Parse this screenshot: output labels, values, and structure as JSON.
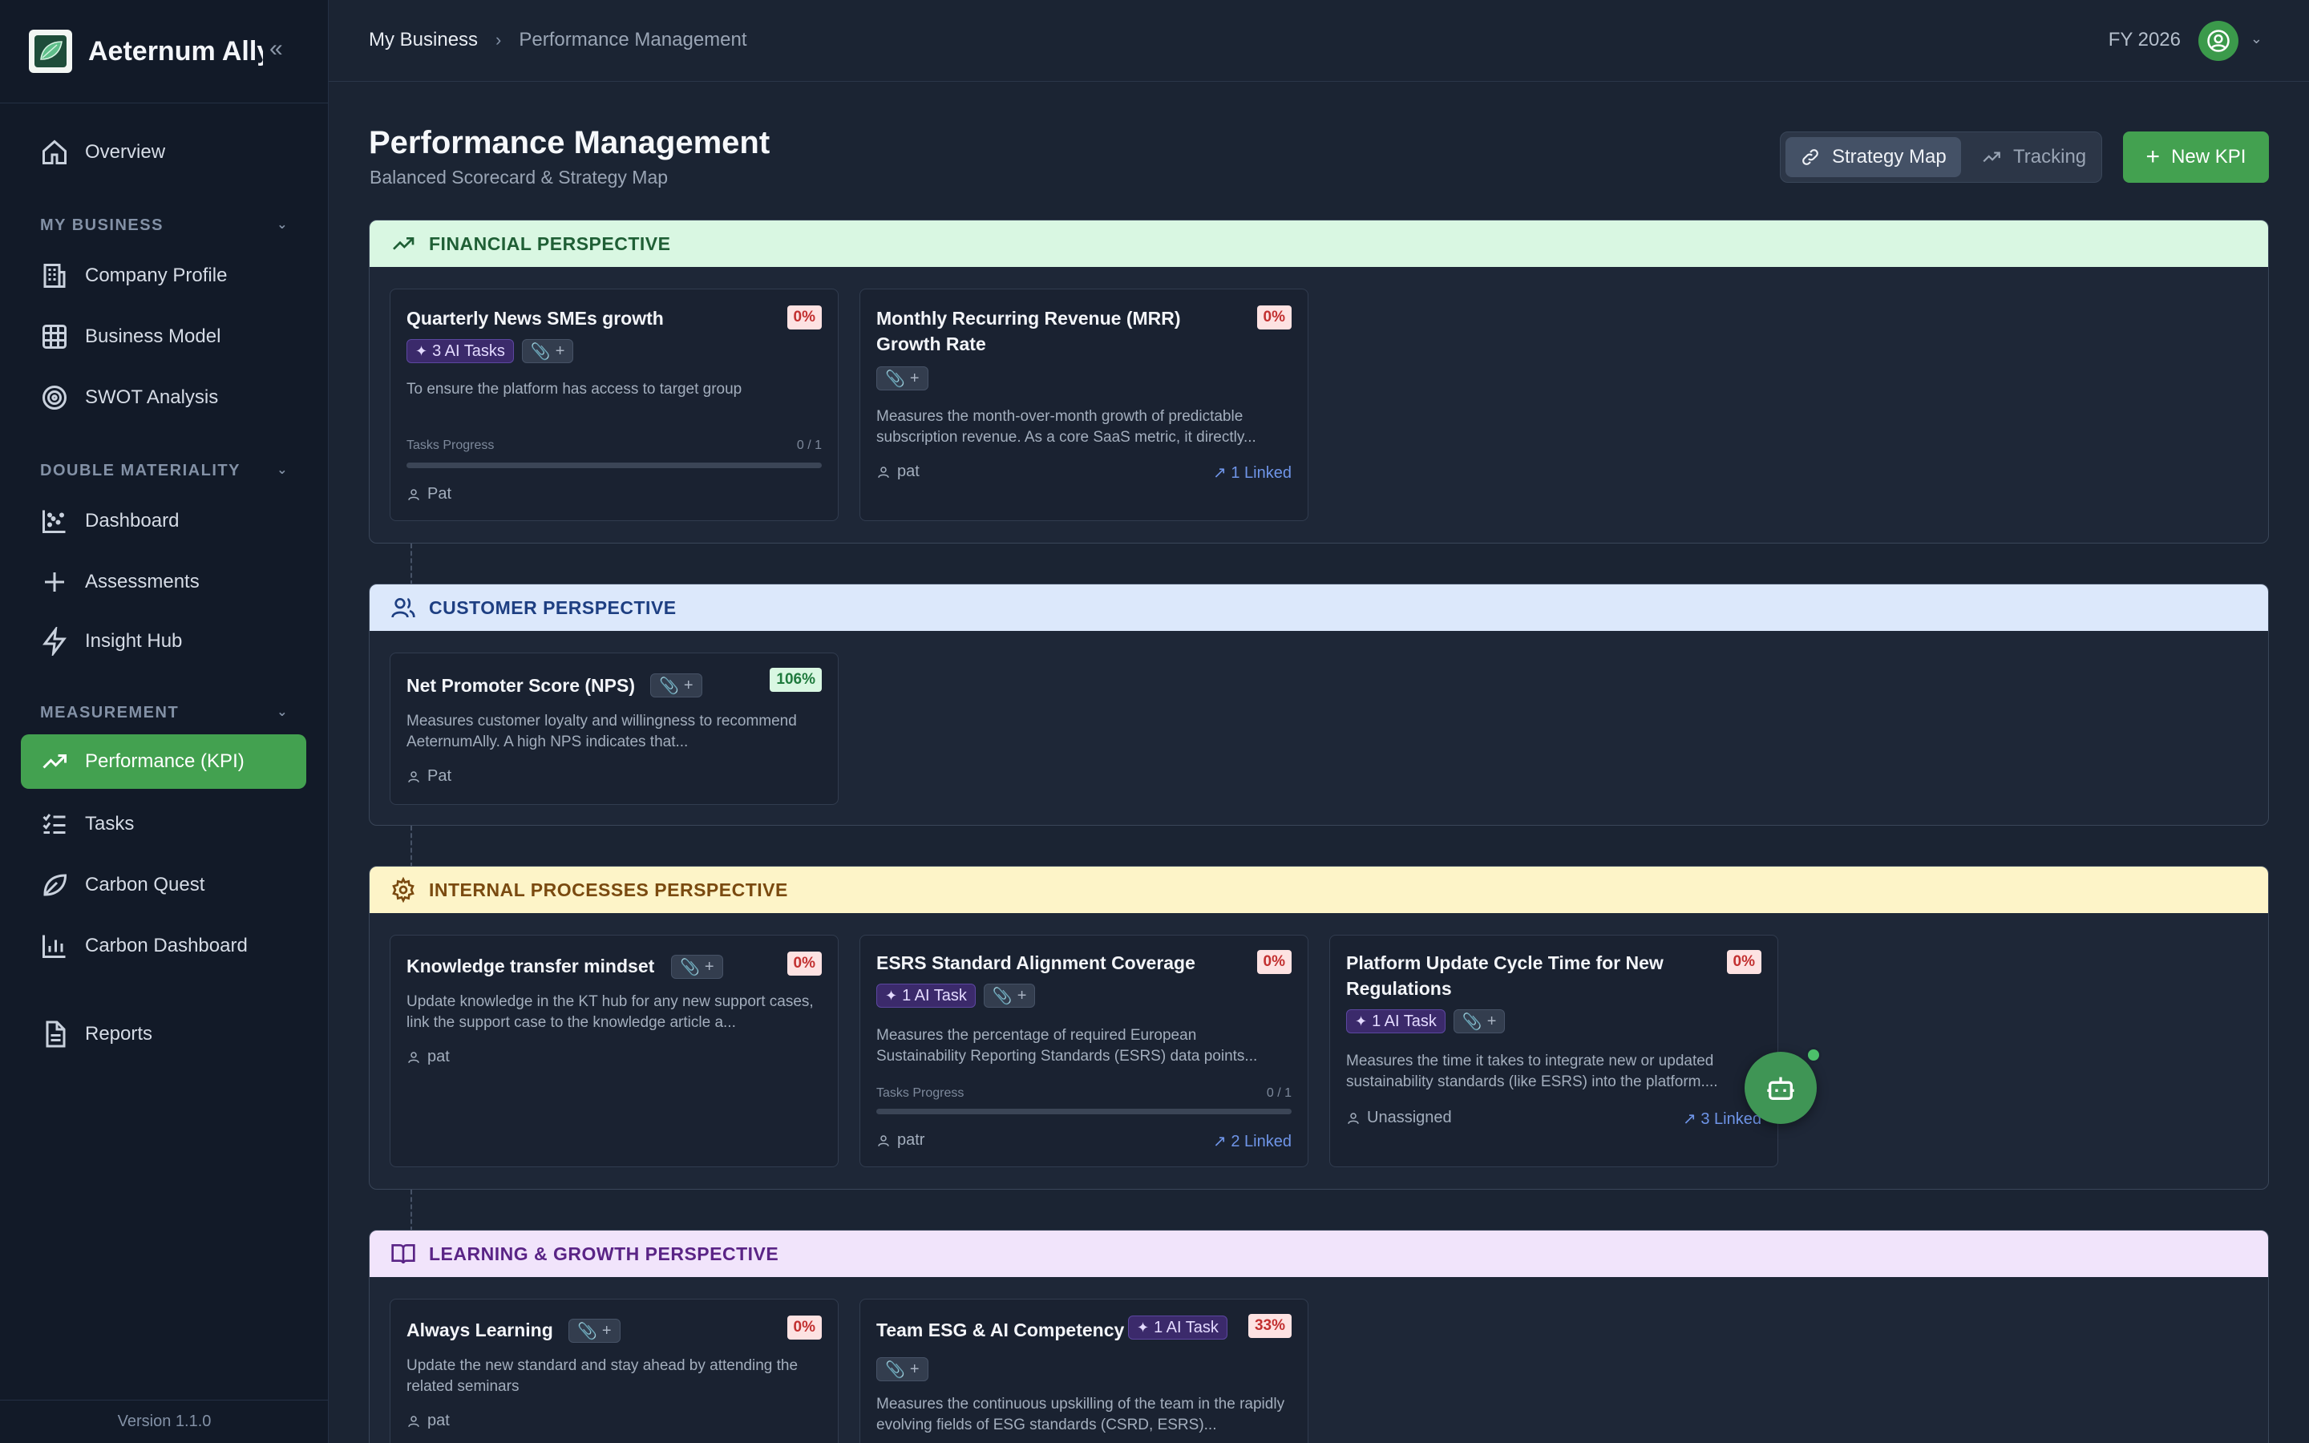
{
  "brand": {
    "name": "Aeternum Ally",
    "collapse_glyph": "«"
  },
  "sidebar": {
    "overview": "Overview",
    "sections": [
      {
        "label": "MY BUSINESS",
        "items": [
          "Company Profile",
          "Business Model",
          "SWOT Analysis"
        ]
      },
      {
        "label": "DOUBLE MATERIALITY",
        "items": [
          "Dashboard",
          "Assessments",
          "Insight Hub"
        ]
      },
      {
        "label": "MEASUREMENT",
        "items": [
          "Performance (KPI)",
          "Tasks",
          "Carbon Quest",
          "Carbon Dashboard"
        ]
      }
    ],
    "reports": "Reports",
    "version": "Version 1.1.0"
  },
  "topbar": {
    "breadcrumb": [
      "My Business",
      "Performance Management"
    ],
    "fiscal_year": "FY 2026"
  },
  "page": {
    "title": "Performance Management",
    "subtitle": "Balanced Scorecard & Strategy Map",
    "view_toggle": {
      "strategy_map": "Strategy Map",
      "tracking": "Tracking"
    },
    "new_kpi": "New KPI"
  },
  "common": {
    "attach_plus": "+",
    "tasks_progress": "Tasks Progress"
  },
  "perspectives": {
    "financial": {
      "title": "FINANCIAL PERSPECTIVE",
      "cards": [
        {
          "title": "Quarterly News SMEs growth",
          "percent": "0%",
          "ai_tasks": "3 AI Tasks",
          "description": "To ensure the platform has access to target group",
          "progress": "0 / 1",
          "progress_fraction": 0,
          "owner": "Pat"
        },
        {
          "title": "Monthly Recurring Revenue (MRR) Growth Rate",
          "percent": "0%",
          "description": "Measures the month-over-month growth of predictable subscription revenue. As a core SaaS metric, it directly...",
          "owner": "pat",
          "linked": "1 Linked"
        }
      ]
    },
    "customer": {
      "title": "CUSTOMER PERSPECTIVE",
      "cards": [
        {
          "title": "Net Promoter Score (NPS)",
          "percent": "106%",
          "description": "Measures customer loyalty and willingness to recommend AeternumAlly. A high NPS indicates that...",
          "owner": "Pat"
        }
      ]
    },
    "internal": {
      "title": "INTERNAL PROCESSES PERSPECTIVE",
      "cards": [
        {
          "title": "Knowledge transfer mindset",
          "percent": "0%",
          "description": "Update knowledge in the KT hub for any new support cases, link the support case to the knowledge article a...",
          "owner": "pat"
        },
        {
          "title": "ESRS Standard Alignment Coverage",
          "percent": "0%",
          "ai_tasks": "1 AI Task",
          "description": "Measures the percentage of required European Sustainability Reporting Standards (ESRS) data points...",
          "progress": "0 / 1",
          "progress_fraction": 0,
          "owner": "patr",
          "linked": "2 Linked"
        },
        {
          "title": "Platform Update Cycle Time for New Regulations",
          "percent": "0%",
          "ai_tasks": "1 AI Task",
          "description": "Measures the time it takes to integrate new or updated sustainability standards (like ESRS) into the platform....",
          "owner": "Unassigned",
          "linked": "3 Linked"
        }
      ]
    },
    "learning": {
      "title": "LEARNING & GROWTH PERSPECTIVE",
      "cards": [
        {
          "title": "Always Learning",
          "percent": "0%",
          "description": "Update the new standard and stay ahead by attending the related seminars",
          "owner": "pat"
        },
        {
          "title": "Team ESG & AI Competency",
          "percent": "33%",
          "ai_tasks": "1 AI Task",
          "description": "Measures the continuous upskilling of the team in the rapidly evolving fields of ESG standards (CSRD, ESRS)..."
        }
      ]
    }
  },
  "colors": {
    "accent_green": "#43a150",
    "bad_percent": "#c23030",
    "good_percent": "#1f7a3d",
    "linked_blue": "#6f95e8",
    "ai_chip": "#3b2a6b"
  },
  "icons": {
    "nav": [
      "home-icon",
      "building-icon",
      "grid-icon",
      "target-icon",
      "scatter-chart-icon",
      "plus-icon",
      "zap-icon",
      "trending-up-icon",
      "list-checks-icon",
      "leaf-icon",
      "bar-chart-icon",
      "file-text-icon"
    ],
    "perspectives": [
      "trending-up-icon",
      "users-icon",
      "gear-icon",
      "book-icon"
    ],
    "assistant": "robot-icon"
  }
}
